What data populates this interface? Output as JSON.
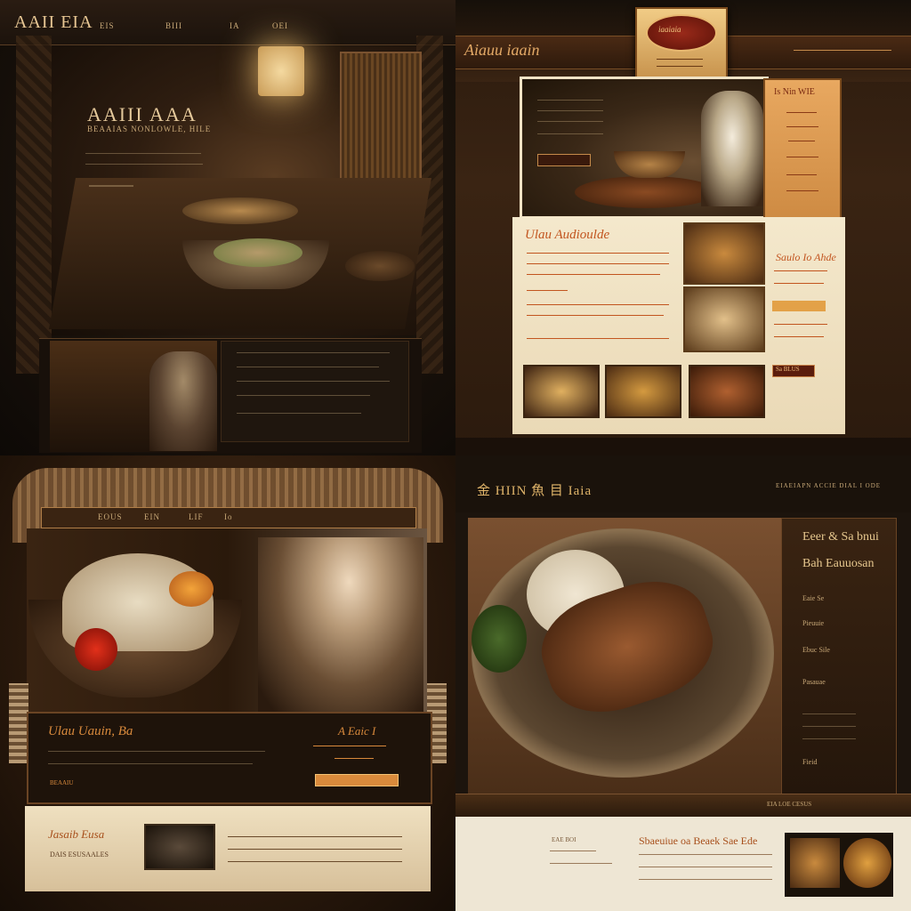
{
  "panel1": {
    "logo": "AAII EIA",
    "nav": [
      "EIS",
      "BIII",
      "IA",
      "OEI"
    ],
    "hero_title": "AAIII AAA",
    "hero_subtitle": "BEAAIAS NONLOWLE, HILE"
  },
  "panel2": {
    "logo": "Aiauu iaain",
    "emblem": "iaaiaia",
    "menu_title": "Is Nin WIE",
    "content_title": "Ulau Audioulde",
    "side_title": "Saulo Io Ahde",
    "side_button": "Sa BLUS"
  },
  "panel3": {
    "nav": [
      "EOUS",
      "EIN",
      "LIF",
      "Io"
    ],
    "band_title": "Ulau Uauin, Ba",
    "band_right": "A Eaic I",
    "band_link": "BEAAIU",
    "lower_title": "Jasaib Eusa",
    "lower_caption": "DAIS ESUSAALES"
  },
  "panel4": {
    "logo": "金 HIIN 魚 目 Iaia",
    "top_nav": "EIAEIAPN ACCIE DIAL I ODE",
    "panel_title_1": "Eeer & Sa bnui",
    "panel_title_2": "Bah Eauuosan",
    "panel_lines": [
      "Eaie Se",
      "Pieuuie",
      "Ebuc Sile",
      "Pasauae",
      "Fieid"
    ],
    "wood_caption": "EIA LOE CESUS",
    "lower_title": "Sbaeuiue oa Beaek Sae Ede",
    "lower_small": "EAE BOI"
  }
}
